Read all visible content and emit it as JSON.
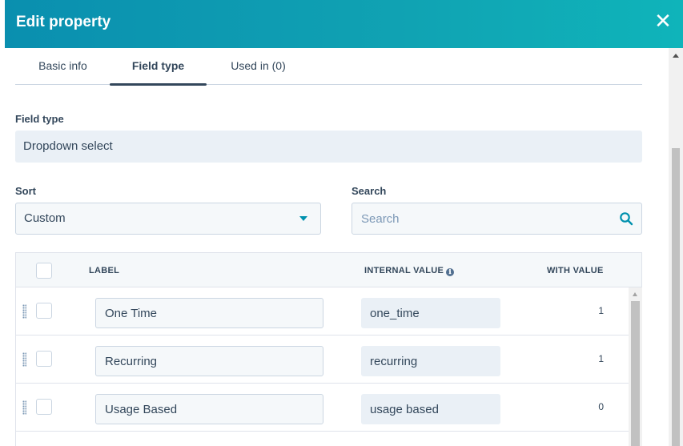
{
  "dialog": {
    "title": "Edit property",
    "close_label": "✕"
  },
  "tabs": [
    {
      "label": "Basic info",
      "active": false
    },
    {
      "label": "Field type",
      "active": true
    },
    {
      "label": "Used in (0)",
      "active": false
    }
  ],
  "field_type": {
    "label": "Field type",
    "value": "Dropdown select"
  },
  "sort": {
    "label": "Sort",
    "value": "Custom"
  },
  "search": {
    "label": "Search",
    "placeholder": "Search",
    "value": ""
  },
  "table": {
    "columns": {
      "label": "LABEL",
      "internal_value": "INTERNAL VALUE",
      "with_value": "WITH VALUE"
    },
    "info_icon": "ℹ",
    "rows": [
      {
        "label": "One Time",
        "internal_value": "one_time",
        "with_value": "1"
      },
      {
        "label": "Recurring",
        "internal_value": "recurring",
        "with_value": "1"
      },
      {
        "label": "Usage Based",
        "internal_value": "usage based",
        "with_value": "0"
      }
    ]
  },
  "colors": {
    "header_start": "#0a8faf",
    "header_end": "#0fb4ba",
    "accent": "#0091ae",
    "text": "#33475b"
  }
}
